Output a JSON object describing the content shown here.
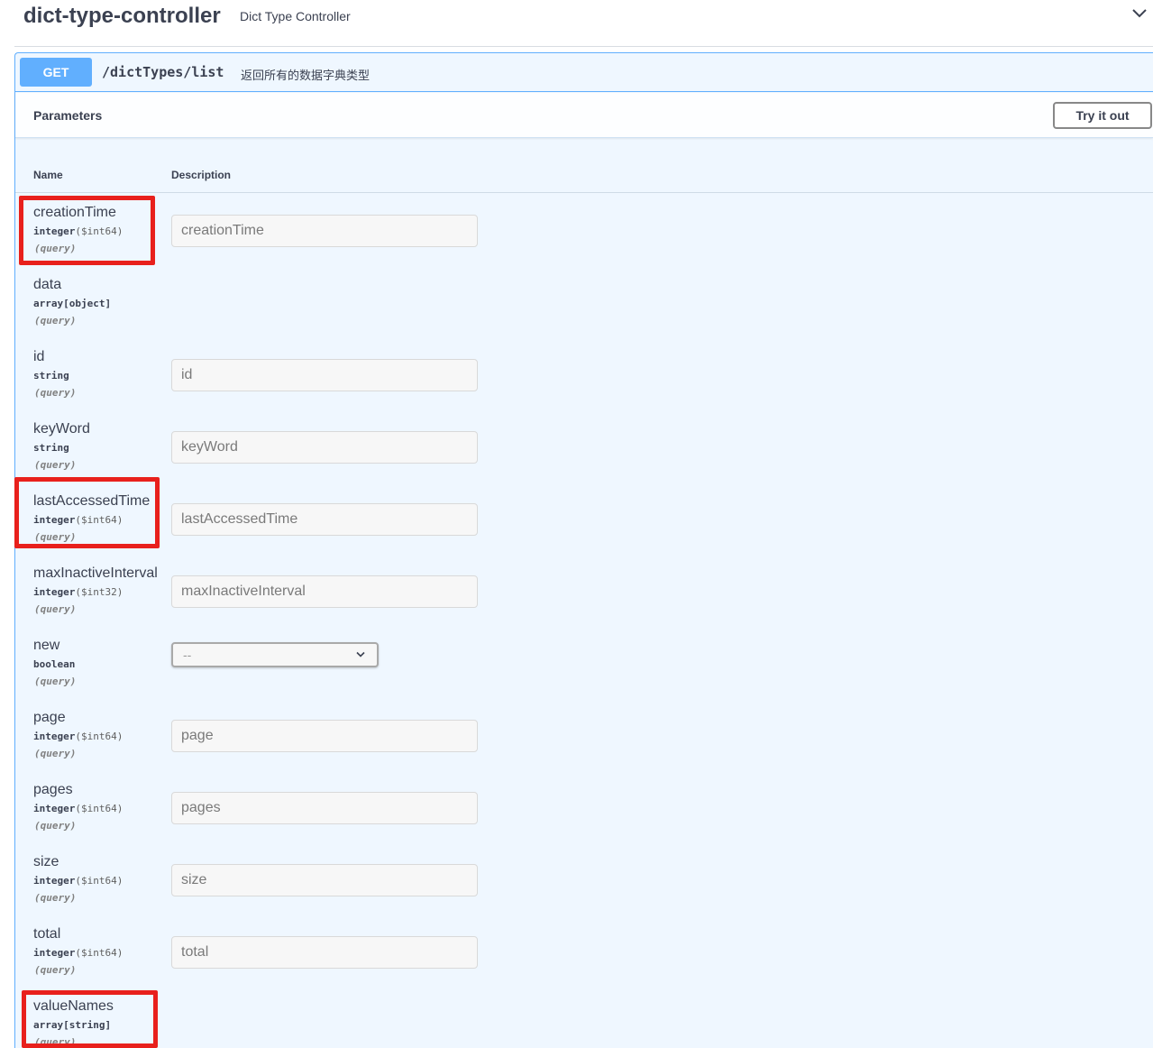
{
  "controller": {
    "title": "dict-type-controller",
    "description": "Dict Type Controller"
  },
  "operation": {
    "method": "GET",
    "path": "/dictTypes/list",
    "summary": "返回所有的数据字典类型"
  },
  "parameters_section": {
    "title": "Parameters",
    "try_button": "Try it out",
    "col_name": "Name",
    "col_description": "Description"
  },
  "params": [
    {
      "name": "creationTime",
      "type": "integer",
      "format": "($int64)",
      "in": "(query)",
      "placeholder": "creationTime"
    },
    {
      "name": "data",
      "type": "array[object]",
      "format": "",
      "in": "(query)"
    },
    {
      "name": "id",
      "type": "string",
      "format": "",
      "in": "(query)",
      "placeholder": "id"
    },
    {
      "name": "keyWord",
      "type": "string",
      "format": "",
      "in": "(query)",
      "placeholder": "keyWord"
    },
    {
      "name": "lastAccessedTime",
      "type": "integer",
      "format": "($int64)",
      "in": "(query)",
      "placeholder": "lastAccessedTime"
    },
    {
      "name": "maxInactiveInterval",
      "type": "integer",
      "format": "($int32)",
      "in": "(query)",
      "placeholder": "maxInactiveInterval"
    },
    {
      "name": "new",
      "type": "boolean",
      "format": "",
      "in": "(query)",
      "select_value": "--"
    },
    {
      "name": "page",
      "type": "integer",
      "format": "($int64)",
      "in": "(query)",
      "placeholder": "page"
    },
    {
      "name": "pages",
      "type": "integer",
      "format": "($int64)",
      "in": "(query)",
      "placeholder": "pages"
    },
    {
      "name": "size",
      "type": "integer",
      "format": "($int64)",
      "in": "(query)",
      "placeholder": "size"
    },
    {
      "name": "total",
      "type": "integer",
      "format": "($int64)",
      "in": "(query)",
      "placeholder": "total"
    },
    {
      "name": "valueNames",
      "type": "array[string]",
      "format": "",
      "in": "(query)"
    }
  ],
  "colors": {
    "get_accent": "#61affe",
    "get_background": "#eff7ff",
    "highlight": "#e8201c"
  },
  "icons": {
    "collapse": "chevron-down-icon",
    "select": "chevron-down-icon"
  }
}
